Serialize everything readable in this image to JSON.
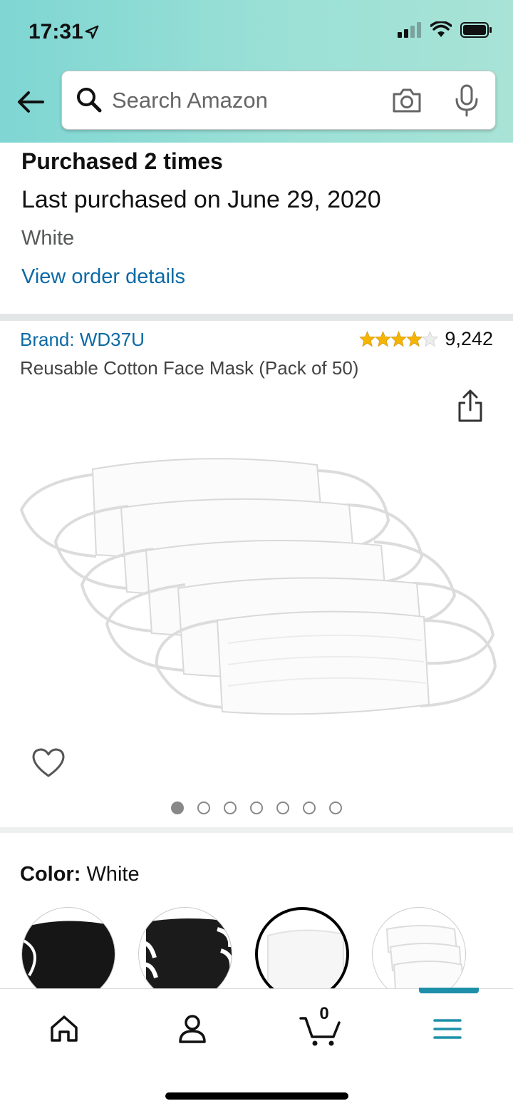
{
  "status_bar": {
    "time": "17:31"
  },
  "search": {
    "placeholder": "Search Amazon"
  },
  "purchase_history": {
    "times": "Purchased 2 times",
    "last": "Last purchased on June 29, 2020",
    "variant": "White",
    "link": "View order details"
  },
  "product": {
    "brand": "Brand: WD37U",
    "rating_stars": 4,
    "rating_count": "9,242",
    "title": "Reusable Cotton Face Mask (Pack of 50)",
    "image_count": 7,
    "active_image": 1
  },
  "color": {
    "label": "Color:",
    "value": "White"
  },
  "tabs": [
    {
      "name": "home"
    },
    {
      "name": "account"
    },
    {
      "name": "cart",
      "count": "0"
    },
    {
      "name": "menu",
      "active": true
    }
  ],
  "colors": {
    "link": "#0b6aa6",
    "star": "#f5b400",
    "accent": "#1e8fa8"
  }
}
